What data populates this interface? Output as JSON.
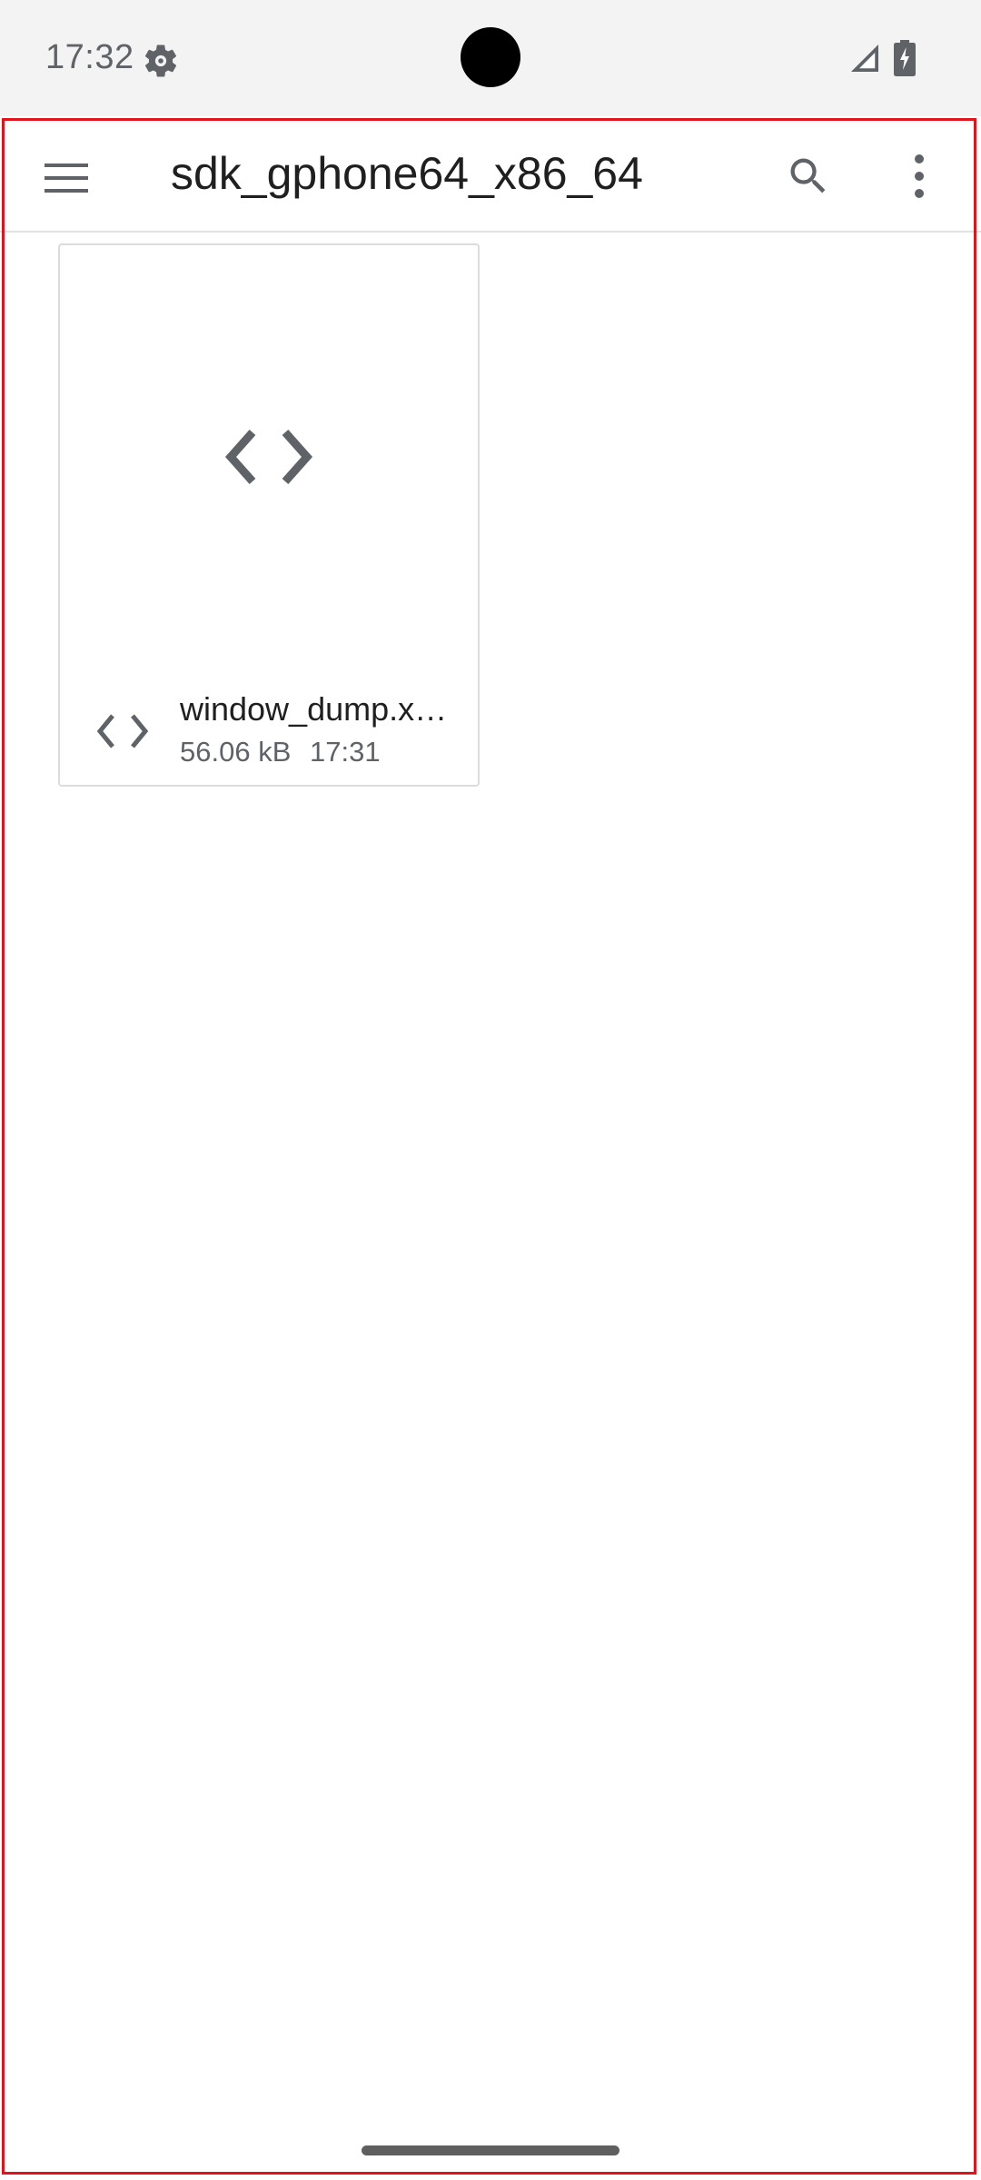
{
  "status_bar": {
    "time": "17:32",
    "icons": [
      "settings-gear-icon",
      "cell-signal-icon",
      "battery-charging-icon"
    ]
  },
  "app_bar": {
    "title": "sdk_gphone64_x86_64",
    "menu_icon": "hamburger-menu-icon",
    "search_icon": "search-icon",
    "more_icon": "more-vert-icon"
  },
  "files": [
    {
      "name": "window_dump.x…",
      "size": "56.06 kB",
      "time": "17:31",
      "type_icon": "code-file-icon"
    }
  ],
  "colors": {
    "frame_outline": "#e1141b",
    "icon_gray": "#5f6368",
    "status_bar_bg": "#f3f3f3"
  }
}
